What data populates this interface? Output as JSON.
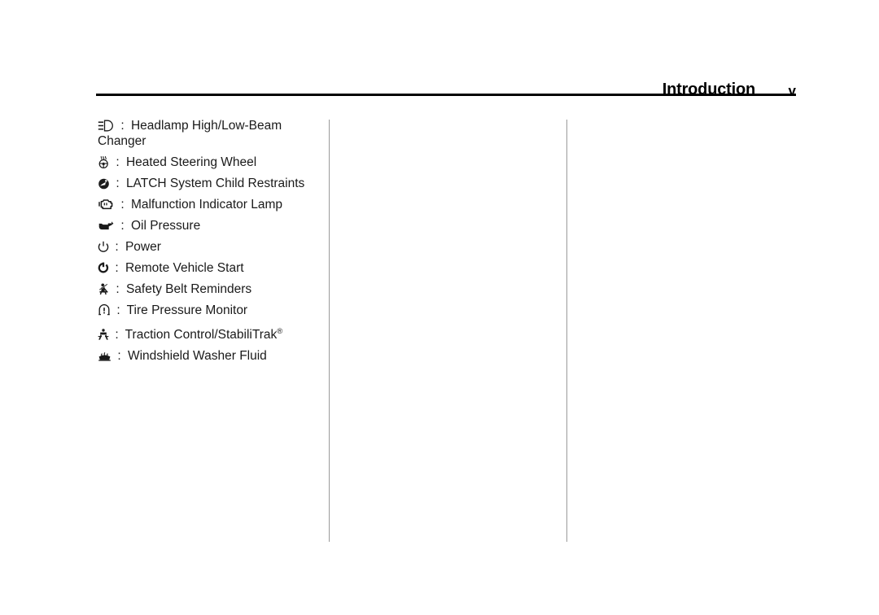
{
  "header": {
    "title": "Introduction",
    "page_number": "v"
  },
  "symbols": {
    "separator": ":",
    "entries": [
      {
        "icon": "headlamp-high-low-beam-icon",
        "label": "Headlamp High/Low-Beam Changer"
      },
      {
        "icon": "heated-steering-wheel-icon",
        "label": "Heated Steering Wheel"
      },
      {
        "icon": "latch-child-restraint-icon",
        "label": "LATCH System Child Restraints"
      },
      {
        "icon": "malfunction-indicator-lamp-icon",
        "label": "Malfunction Indicator Lamp"
      },
      {
        "icon": "oil-pressure-icon",
        "label": "Oil Pressure"
      },
      {
        "icon": "power-icon",
        "label": "Power"
      },
      {
        "icon": "remote-vehicle-start-icon",
        "label": "Remote Vehicle Start"
      },
      {
        "icon": "safety-belt-reminder-icon",
        "label": "Safety Belt Reminders"
      },
      {
        "icon": "tire-pressure-monitor-icon",
        "label": "Tire Pressure Monitor"
      },
      {
        "icon": "traction-control-icon",
        "label": "Traction Control/StabiliTrak",
        "trademark": "®"
      },
      {
        "icon": "windshield-washer-fluid-icon",
        "label": "Windshield Washer Fluid"
      }
    ]
  },
  "colors": {
    "text": "#1a1a1a",
    "rule": "#000000",
    "divider": "#9a9a9a",
    "background": "#ffffff"
  }
}
